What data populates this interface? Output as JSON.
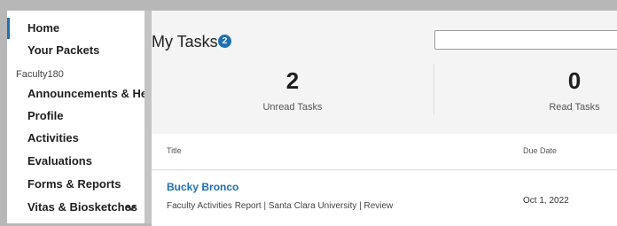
{
  "sidebar": {
    "items_top": [
      {
        "label": "Home"
      },
      {
        "label": "Your Packets"
      }
    ],
    "group_label": "Faculty180",
    "items_group": [
      {
        "label": "Announcements & Help"
      },
      {
        "label": "Profile"
      },
      {
        "label": "Activities"
      },
      {
        "label": "Evaluations"
      },
      {
        "label": "Forms & Reports"
      },
      {
        "label": "Vitas & Biosketches",
        "icon": "chevron-down-icon"
      }
    ]
  },
  "main": {
    "title": "My Tasks",
    "badge_count": "2",
    "search": {
      "value": "",
      "placeholder": ""
    },
    "stats": [
      {
        "value": "2",
        "label": "Unread Tasks"
      },
      {
        "value": "0",
        "label": "Read Tasks"
      }
    ],
    "table": {
      "columns": [
        "Title",
        "Due Date"
      ],
      "rows": [
        {
          "name": "Bucky Bronco",
          "description": "Faculty Activities Report | Santa Clara University | Review",
          "due_date": "Oct 1, 2022"
        }
      ]
    }
  },
  "colors": {
    "accent": "#1f6fb5",
    "background": "#f4f4f4"
  }
}
